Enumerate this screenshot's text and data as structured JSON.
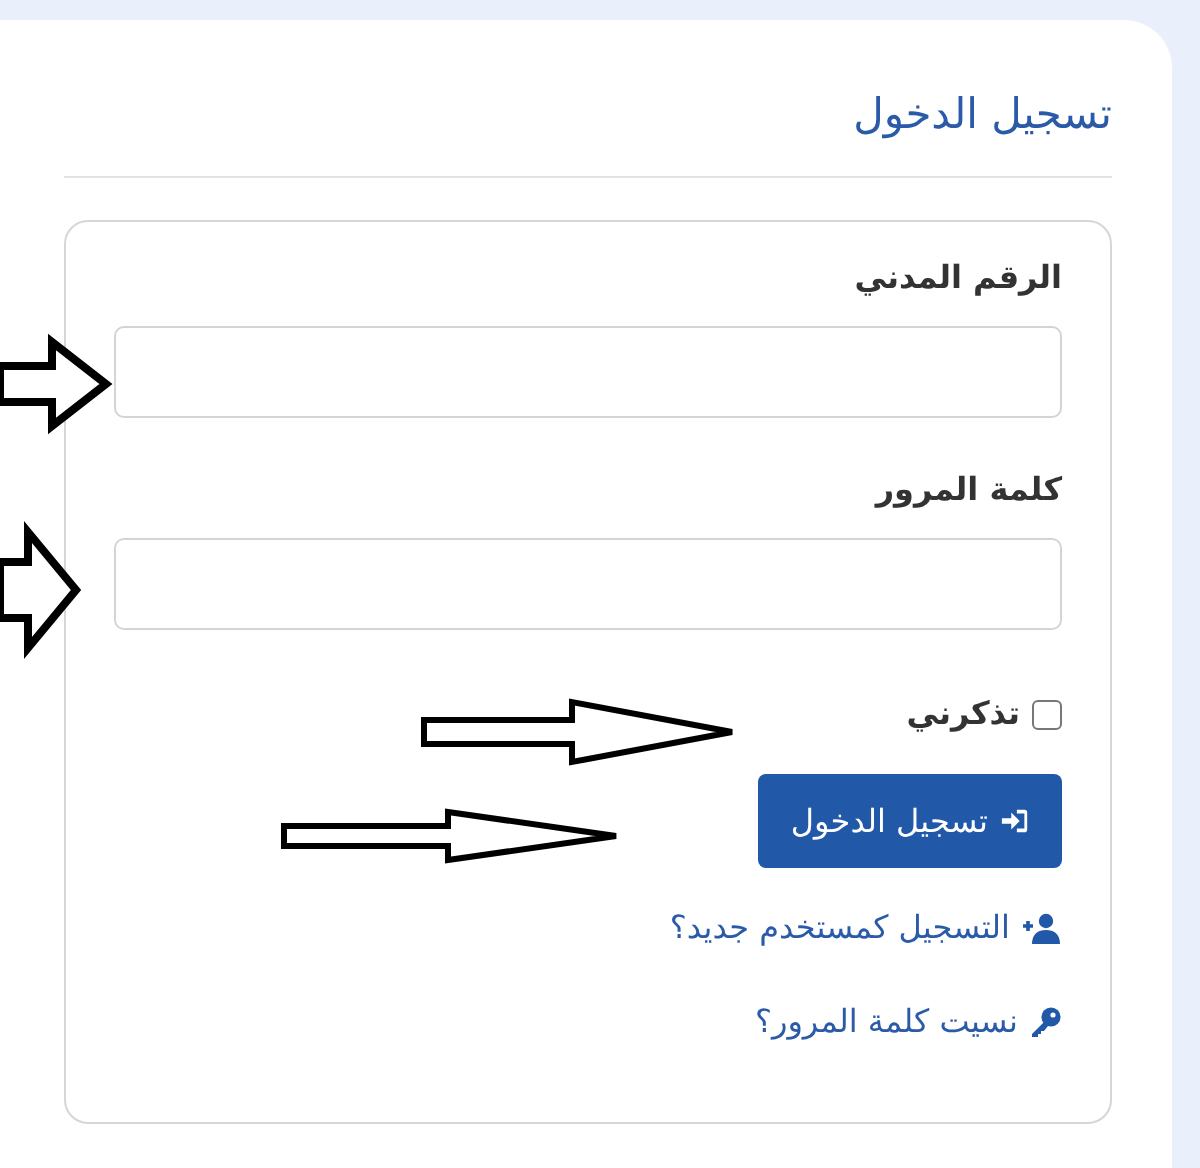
{
  "title": "تسجيل الدخول",
  "fields": [
    {
      "label": "الرقم المدني"
    },
    {
      "label": "كلمة المرور"
    }
  ],
  "remember": {
    "label": "تذكرني",
    "checked": false
  },
  "submit": {
    "label": "تسجيل الدخول"
  },
  "links": [
    {
      "label": "التسجيل كمستخدم جديد؟",
      "kind": "register"
    },
    {
      "label": "نسيت كلمة المرور؟",
      "kind": "forgot"
    }
  ]
}
